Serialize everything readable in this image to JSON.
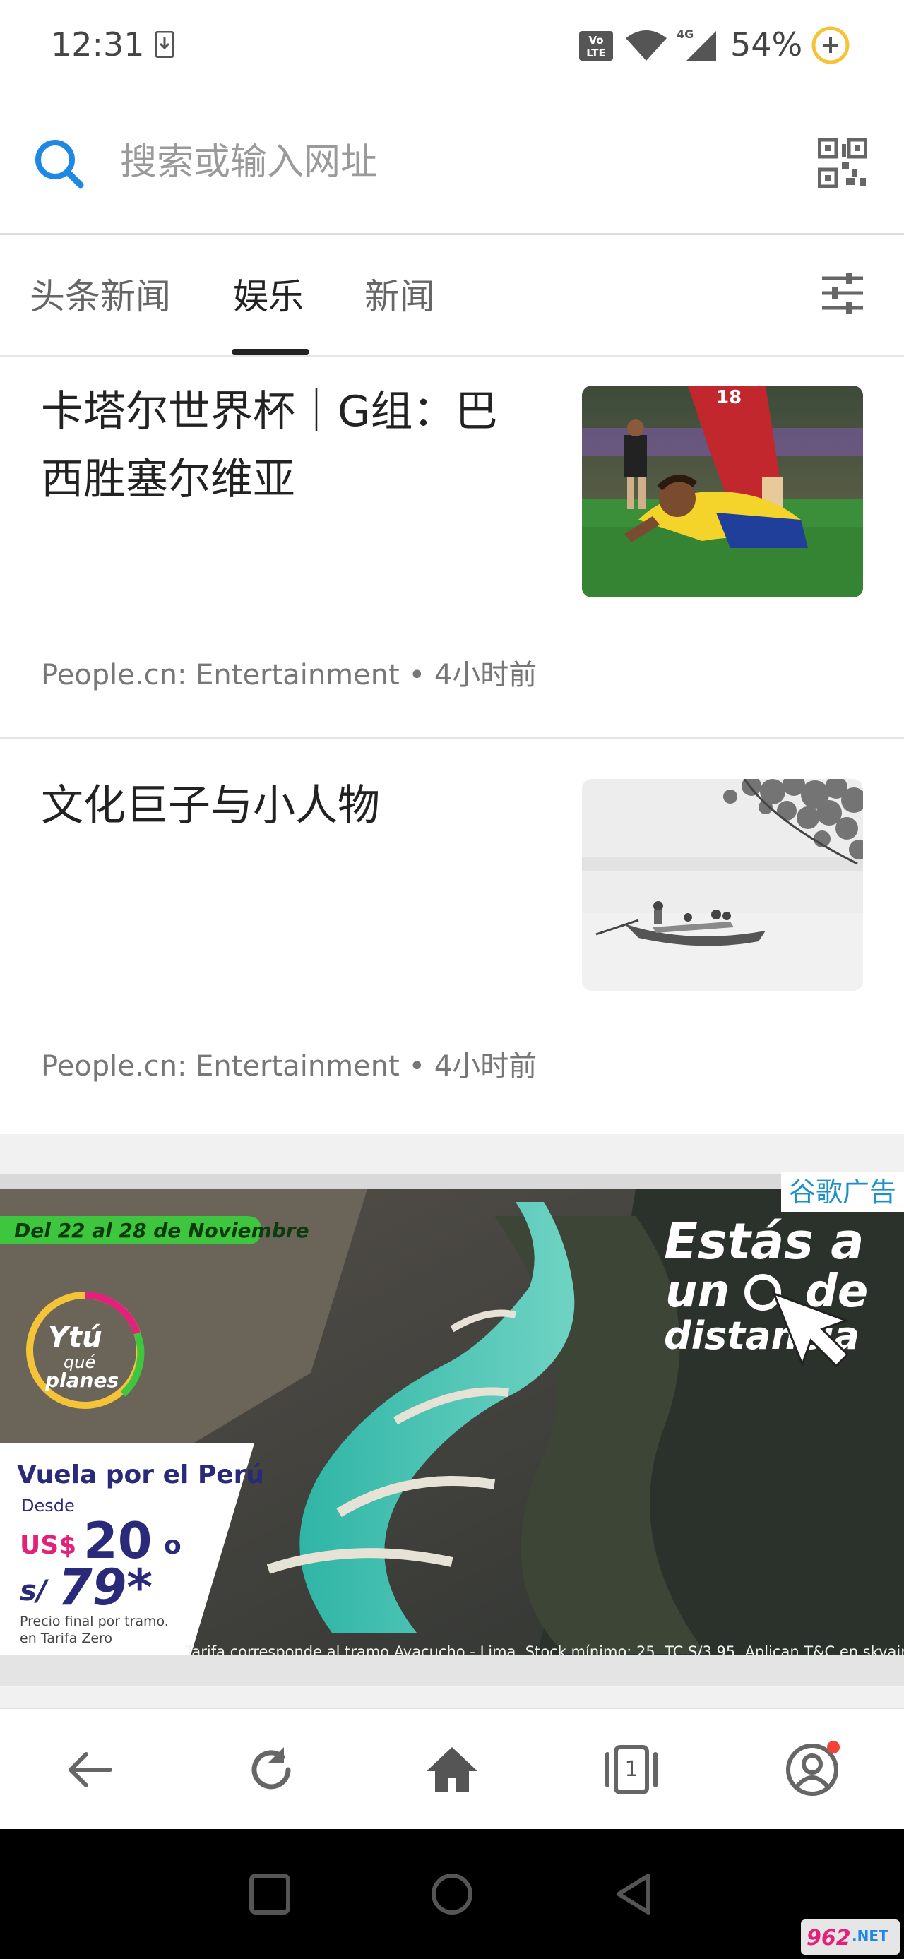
{
  "status_bar": {
    "time": "12:31",
    "battery": "54%",
    "network": "4G"
  },
  "search": {
    "placeholder": "搜索或输入网址"
  },
  "tabs": [
    {
      "label": "头条新闻",
      "active": false
    },
    {
      "label": "娱乐",
      "active": true
    },
    {
      "label": "新闻",
      "active": false
    }
  ],
  "articles": [
    {
      "title": "卡塔尔世界杯｜G组：巴西胜塞尔维亚",
      "source": "People.cn: Entertainment",
      "time": "4小时前",
      "meta": "People.cn: Entertainment • 4小时前"
    },
    {
      "title": "文化巨子与小人物",
      "source": "People.cn: Entertainment",
      "time": "4小时前",
      "meta": "People.cn: Entertainment • 4小时前"
    }
  ],
  "ad": {
    "label": "谷歌广告",
    "date_badge": "Del 22 al 28 de Noviembre",
    "logo_line1": "Ytú",
    "logo_line2": "qué",
    "logo_line3": "planes",
    "headline_line1": "Estás a",
    "headline_line2": "un",
    "headline_line2b": "de",
    "headline_line3": "distancia",
    "promo_title": "Vuela por el Perú",
    "promo_from": "Desde",
    "price_usd_prefix": "US$",
    "price_usd": "20",
    "price_or": "o",
    "price_sol_prefix": "s/",
    "price_sol": "79*",
    "fine_print_1": "Precio final por tramo.",
    "fine_print_2": "en Tarifa Zero",
    "disclaimer": "Tarifa corresponde al tramo Ayacucho - Lima. Stock mínimo: 25. TC S/3.95. Aplican T&C en skyairline.com"
  },
  "toolbar": {
    "tab_count": "1"
  },
  "watermark": "962.NET",
  "colors": {
    "accent_blue": "#1e88e5",
    "ad_label": "#1e90c8",
    "ad_green": "#3ec63e",
    "notification_dot": "#f44336"
  }
}
